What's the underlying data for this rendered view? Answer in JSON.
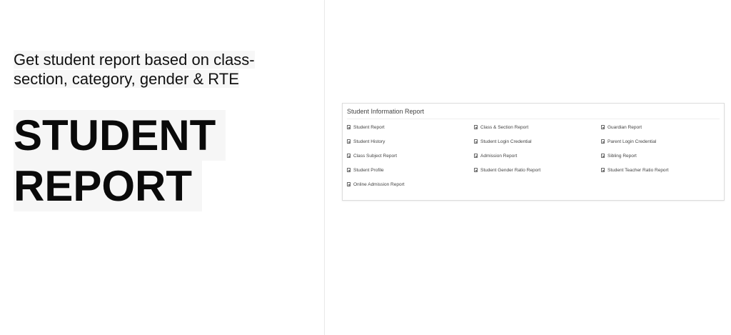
{
  "hero": {
    "tagline_line1": "Get student report based on class-",
    "tagline_line2": "section, category, gender & RTE",
    "headline_line1": "STUDENT",
    "headline_line2": "REPORT"
  },
  "report_card": {
    "title": "Student Information Report",
    "items": [
      "Student Report",
      "Class & Section Report",
      "Guardian Report",
      "Student History",
      "Student Login Credential",
      "Parent Login Credential",
      "Class Subject Report",
      "Admission Report",
      "Sibling Report",
      "Student Profile",
      "Student Gender Ratio Report",
      "Student Teacher Ratio Report",
      "Online Admission Report"
    ],
    "icon": "document-icon"
  }
}
